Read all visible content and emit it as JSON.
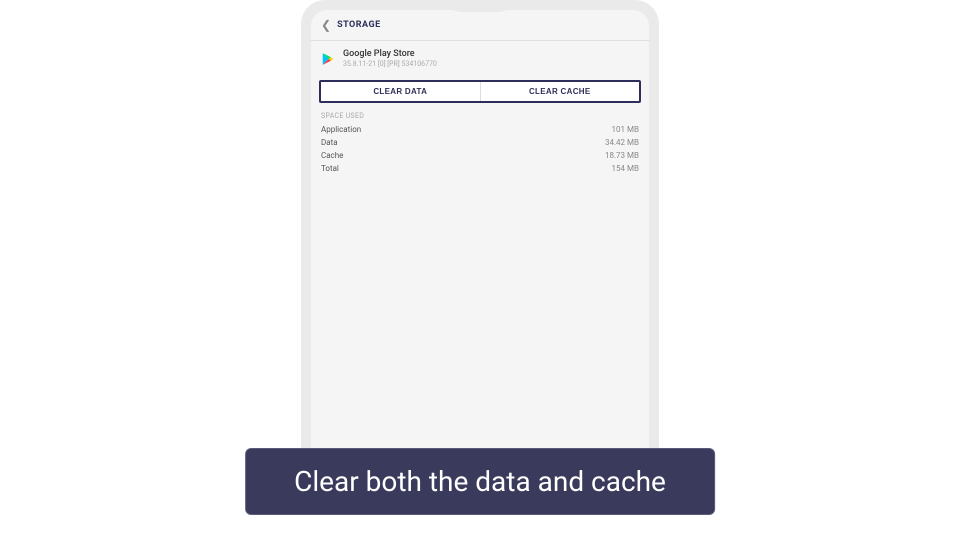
{
  "header": {
    "title": "STORAGE"
  },
  "app": {
    "name": "Google Play Store",
    "version": "35.8.11-21 [0] [PR] 534106770"
  },
  "buttons": {
    "clear_data": "CLEAR DATA",
    "clear_cache": "CLEAR CACHE"
  },
  "section_label": "SPACE USED",
  "stats": [
    {
      "label": "Application",
      "value": "101 MB"
    },
    {
      "label": "Data",
      "value": "34.42 MB"
    },
    {
      "label": "Cache",
      "value": "18.73 MB"
    },
    {
      "label": "Total",
      "value": "154 MB"
    }
  ],
  "caption": "Clear both the data and cache"
}
